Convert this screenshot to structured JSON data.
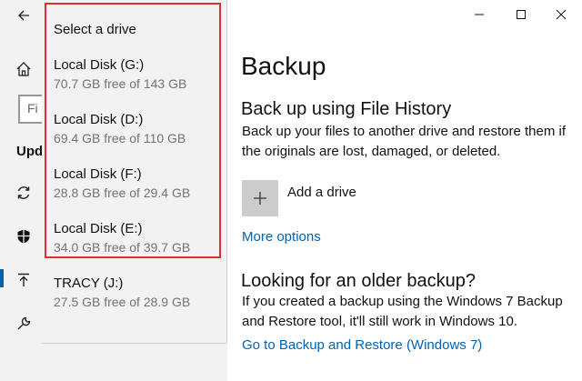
{
  "window": {
    "back_icon": "back-arrow-icon",
    "caption_buttons": [
      "minimize-icon",
      "maximize-icon",
      "close-icon"
    ]
  },
  "nav": {
    "search_placeholder": "Fi",
    "section_label": "Upd",
    "icons": [
      "home-icon",
      "sync-icon",
      "shield-icon",
      "backup-icon",
      "wrench-icon"
    ]
  },
  "drive_popup": {
    "title": "Select a drive",
    "drives": [
      {
        "name": "Local Disk (G:)",
        "free": "70.7 GB free of 143 GB"
      },
      {
        "name": "Local Disk (D:)",
        "free": "69.4 GB free of 110 GB"
      },
      {
        "name": "Local Disk (F:)",
        "free": "28.8 GB free of 29.4 GB"
      },
      {
        "name": "Local Disk (E:)",
        "free": "34.0 GB free of 39.7 GB"
      },
      {
        "name": "TRACY (J:)",
        "free": "27.5 GB free of 28.9 GB"
      }
    ],
    "highlight_color": "#d93030"
  },
  "main": {
    "title": "Backup",
    "file_history": {
      "heading": "Back up using File History",
      "description": "Back up your files to another drive and restore them if the originals are lost, damaged, or deleted.",
      "add_drive_label": "Add a drive",
      "more_options_link": "More options"
    },
    "older_backup": {
      "heading": "Looking for an older backup?",
      "description": "If you created a backup using the Windows 7 Backup and Restore tool, it'll still work in Windows 10.",
      "link": "Go to Backup and Restore (Windows 7)"
    }
  },
  "colors": {
    "accent": "#0063b1",
    "nav_background": "#f2f2f2"
  }
}
